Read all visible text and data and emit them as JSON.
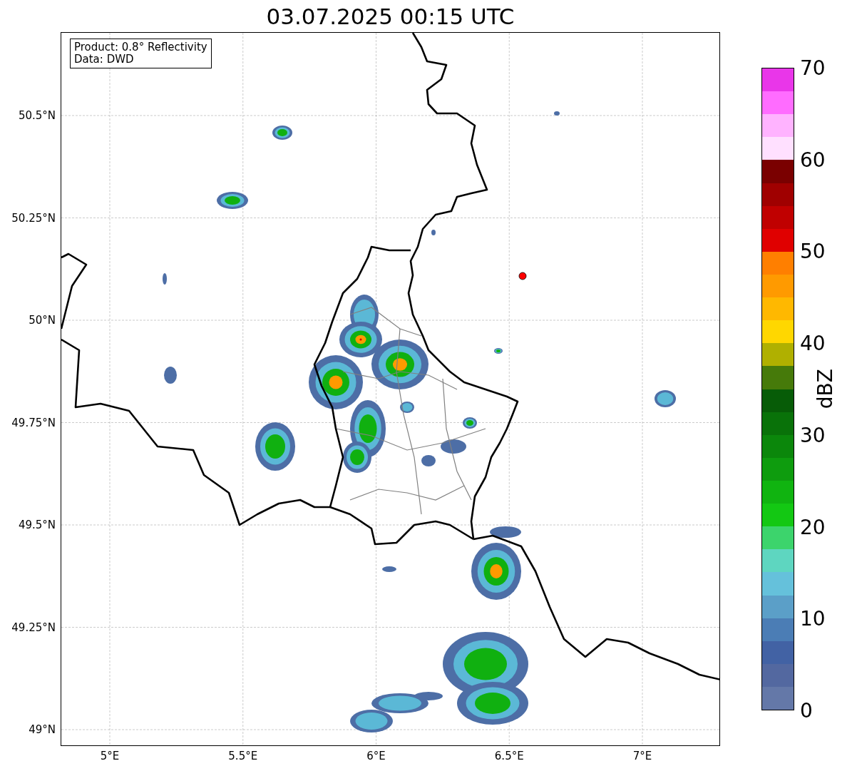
{
  "title": "03.07.2025 00:15 UTC",
  "legend": [
    "Product: 0.8° Reflectivity",
    "Data: DWD"
  ],
  "x_axis": {
    "ticks": [
      "5°E",
      "5.5°E",
      "6°E",
      "6.5°E",
      "7°E"
    ]
  },
  "y_axis": {
    "ticks": [
      "50.5°N",
      "50.25°N",
      "50°N",
      "49.75°N",
      "49.5°N",
      "49.25°N",
      "49°N"
    ]
  },
  "colorbar": {
    "label": "dBZ",
    "ticks": [
      "70",
      "60",
      "50",
      "40",
      "30",
      "20",
      "10",
      "0"
    ],
    "segments": [
      {
        "color": "#e936e9"
      },
      {
        "color": "#ff6cff"
      },
      {
        "color": "#ffb3ff"
      },
      {
        "color": "#ffe0ff"
      },
      {
        "color": "#7a0000"
      },
      {
        "color": "#a00000"
      },
      {
        "color": "#c00000"
      },
      {
        "color": "#e00000"
      },
      {
        "color": "#ff7f00"
      },
      {
        "color": "#ff9a00"
      },
      {
        "color": "#ffb800"
      },
      {
        "color": "#ffd700"
      },
      {
        "color": "#b0b000"
      },
      {
        "color": "#467a0a"
      },
      {
        "color": "#075c07"
      },
      {
        "color": "#097209"
      },
      {
        "color": "#0b870b"
      },
      {
        "color": "#0e9c0e"
      },
      {
        "color": "#10b410"
      },
      {
        "color": "#13c813"
      },
      {
        "color": "#3cd46c"
      },
      {
        "color": "#5ed6c0"
      },
      {
        "color": "#65c1db"
      },
      {
        "color": "#5b9fc8"
      },
      {
        "color": "#4b7db5"
      },
      {
        "color": "#4262a4"
      },
      {
        "color": "#5368a0"
      },
      {
        "color": "#6478a8"
      }
    ]
  }
}
